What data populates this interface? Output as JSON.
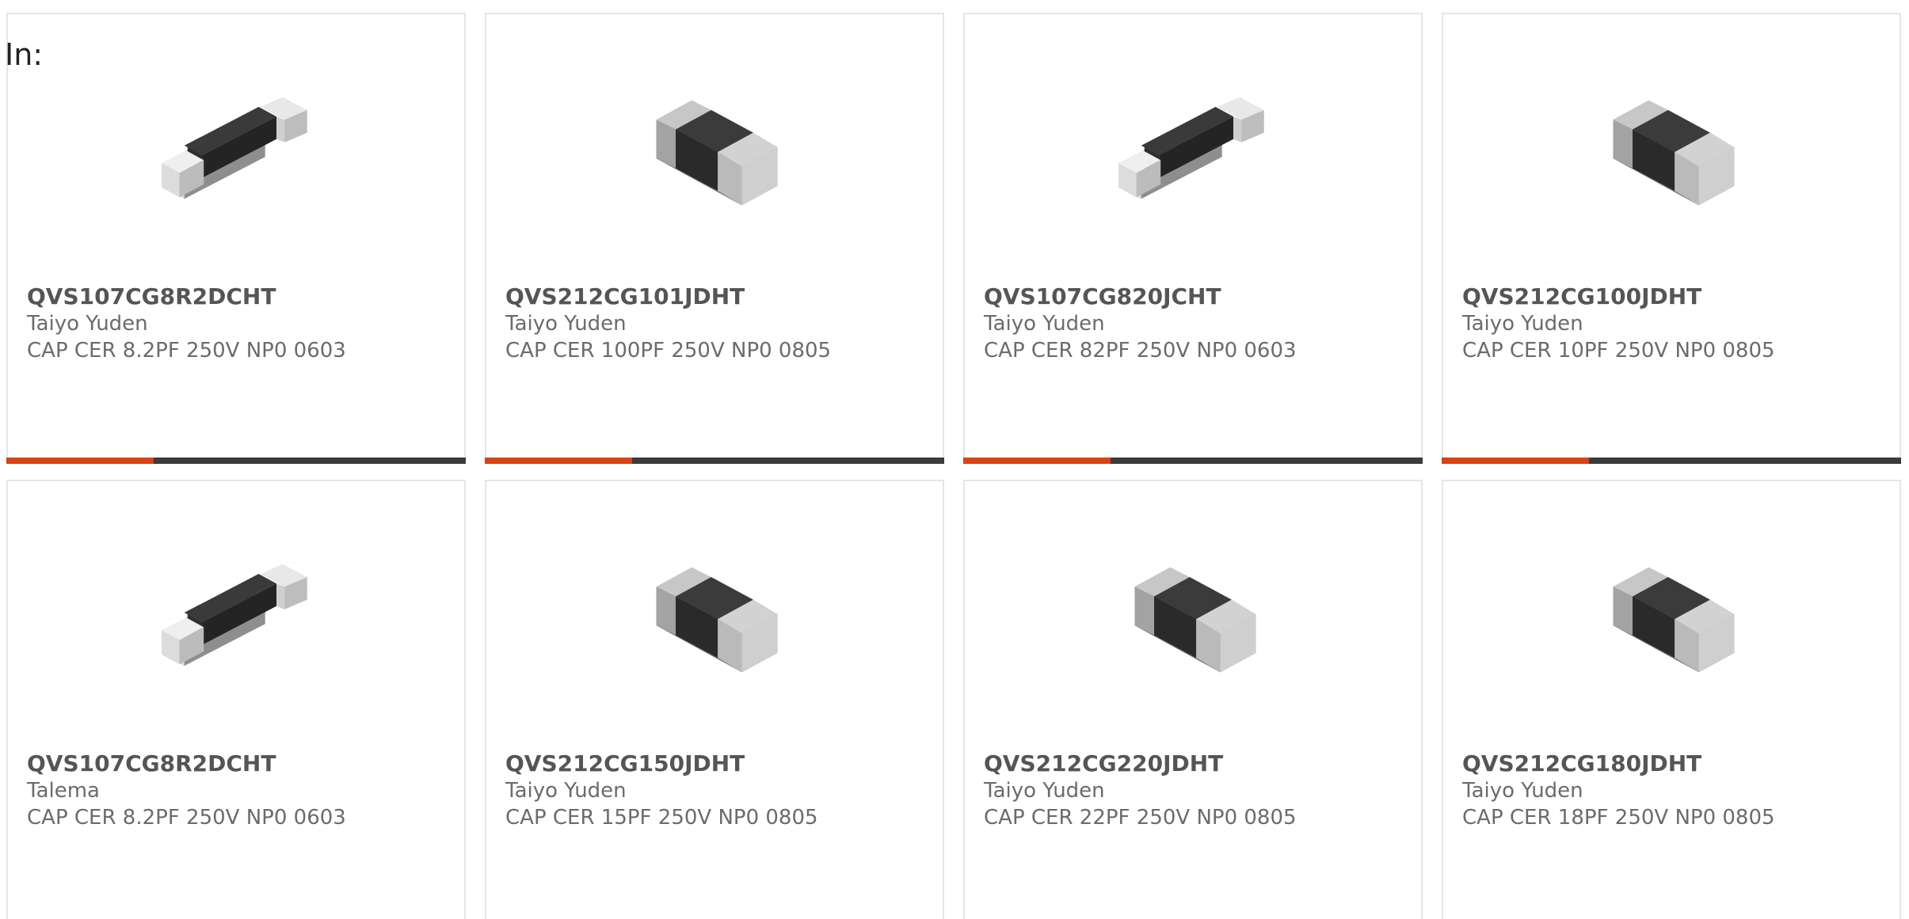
{
  "filter": {
    "label": "In:"
  },
  "colors": {
    "accent": "#d84315",
    "bar": "#3b3b3b",
    "border": "#e6e6e6"
  },
  "products": [
    {
      "part_number": "QVS107CG8R2DCHT",
      "manufacturer": "Taiyo Yuden",
      "description": "CAP CER 8.2PF 250V NP0 0603",
      "image_icon": "chip-capacitor-0603-icon",
      "progress": 0.32
    },
    {
      "part_number": "QVS212CG101JDHT",
      "manufacturer": "Taiyo Yuden",
      "description": "CAP CER 100PF 250V NP0 0805",
      "image_icon": "chip-capacitor-0805-icon",
      "progress": 0.32
    },
    {
      "part_number": "QVS107CG820JCHT",
      "manufacturer": "Taiyo Yuden",
      "description": "CAP CER 82PF 250V NP0 0603",
      "image_icon": "chip-capacitor-0603-icon",
      "progress": 0.32
    },
    {
      "part_number": "QVS212CG100JDHT",
      "manufacturer": "Taiyo Yuden",
      "description": "CAP CER 10PF 250V NP0 0805",
      "image_icon": "chip-capacitor-0805-icon",
      "progress": 0.32
    },
    {
      "part_number": "QVS107CG8R2DCHT",
      "manufacturer": "Talema",
      "description": "CAP CER 8.2PF 250V NP0 0603",
      "image_icon": "chip-capacitor-0603-icon"
    },
    {
      "part_number": "QVS212CG150JDHT",
      "manufacturer": "Taiyo Yuden",
      "description": "CAP CER 15PF 250V NP0 0805",
      "image_icon": "chip-capacitor-0805-icon"
    },
    {
      "part_number": "QVS212CG220JDHT",
      "manufacturer": "Taiyo Yuden",
      "description": "CAP CER 22PF 250V NP0 0805",
      "image_icon": "chip-capacitor-0805-icon"
    },
    {
      "part_number": "QVS212CG180JDHT",
      "manufacturer": "Taiyo Yuden",
      "description": "CAP CER 18PF 250V NP0 0805",
      "image_icon": "chip-capacitor-0805-icon"
    }
  ]
}
